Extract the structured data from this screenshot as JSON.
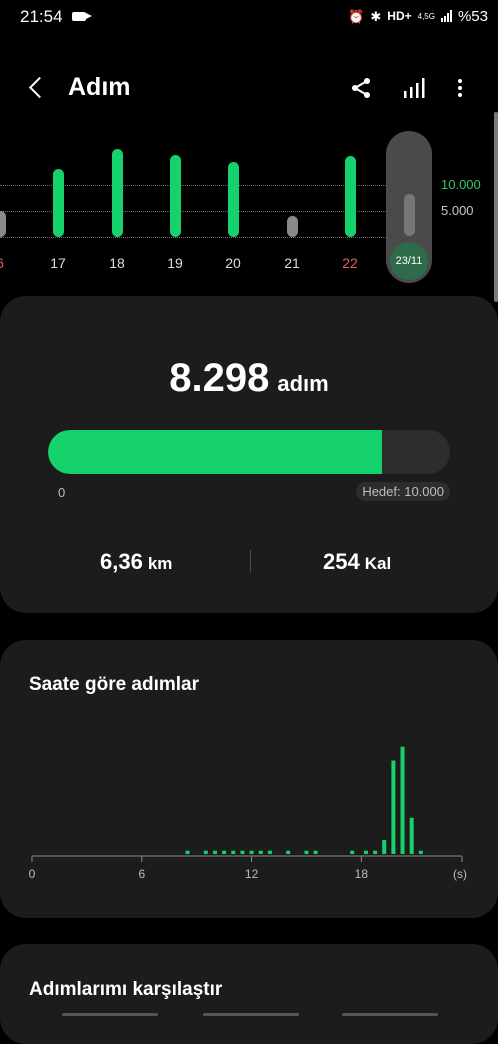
{
  "status_bar": {
    "time": "21:54",
    "network": "HD+",
    "network_gen": "4,5G",
    "battery": "%53"
  },
  "header": {
    "title": "Adım"
  },
  "week_chart": {
    "goal_label": "10.000",
    "mid_label": "5.000",
    "days": [
      {
        "label": "6",
        "steps": 4300,
        "goal_met": false,
        "red": true
      },
      {
        "label": "17",
        "steps": 11500,
        "goal_met": true,
        "red": false
      },
      {
        "label": "18",
        "steps": 14800,
        "goal_met": true,
        "red": false
      },
      {
        "label": "19",
        "steps": 13800,
        "goal_met": true,
        "red": false
      },
      {
        "label": "20",
        "steps": 12600,
        "goal_met": true,
        "red": false
      },
      {
        "label": "21",
        "steps": 3500,
        "goal_met": false,
        "red": false
      },
      {
        "label": "22",
        "steps": 13700,
        "goal_met": true,
        "red": true
      },
      {
        "label": "23/11",
        "steps": 8298,
        "goal_met": false,
        "red": false,
        "selected": true
      }
    ],
    "colors": {
      "goal_met": "#16d26c",
      "below_goal": "#8a8a8a"
    }
  },
  "summary": {
    "steps": "8.298",
    "steps_unit": "adım",
    "progress_fraction": 0.83,
    "progress_start": "0",
    "goal": "Hedef: 10.000",
    "distance": "6,36",
    "distance_unit": "km",
    "calories": "254",
    "calories_unit": "Kal"
  },
  "chart_data": {
    "type": "bar",
    "title": "Saate göre adımlar",
    "x": [
      8.5,
      9.5,
      10,
      10.5,
      11,
      11.5,
      12,
      12.5,
      13,
      14,
      15,
      15.5,
      17.5,
      18.25,
      18.75,
      19.25,
      19.75,
      20.25,
      20.75,
      21.25
    ],
    "values": [
      5,
      5,
      5,
      5,
      5,
      5,
      5,
      5,
      5,
      5,
      5,
      5,
      5,
      5,
      5,
      15,
      90,
      103,
      36,
      5
    ],
    "xlim": [
      0,
      23.5
    ],
    "ylim": [
      0,
      115
    ],
    "xticks": [
      "0",
      "6",
      "12",
      "18"
    ],
    "xticks_at": [
      0,
      6,
      12,
      18
    ],
    "unit_label": "(s)",
    "color": "#16d26c"
  },
  "compare": {
    "title": "Adımlarımı karşılaştır"
  }
}
